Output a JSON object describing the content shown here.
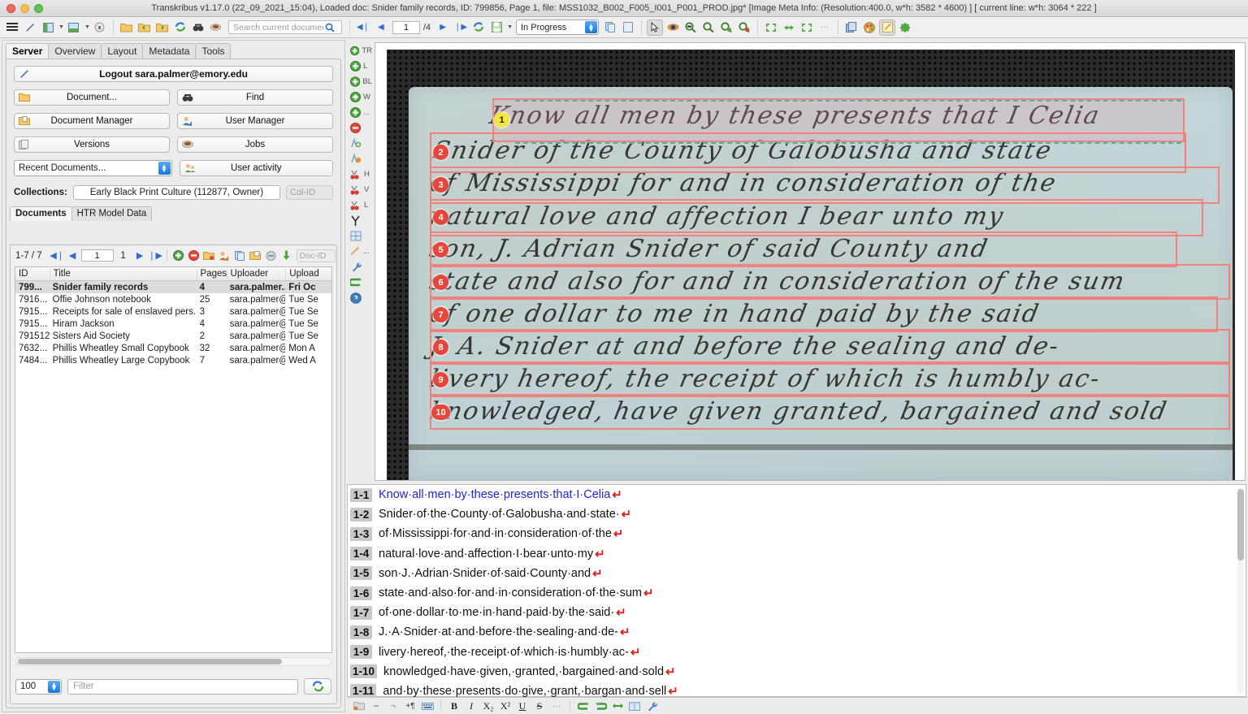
{
  "window": {
    "title": "Transkribus v1.17.0 (22_09_2021_15:04), Loaded doc: Snider family records, ID: 799856, Page 1, file: MSS1032_B002_F005_I001_P001_PROD.jpg* [Image Meta Info: (Resolution:400.0, w*h: 3582 * 4600) ] [ current line: w*h: 3064 * 222 ]"
  },
  "toolbar": {
    "search_placeholder": "Search current document...",
    "page_value": "1",
    "page_total": "/4",
    "status_value": "In Progress",
    "icons": [
      "hamburger-menu-icon",
      "pen-icon",
      "split-horizontal-icon",
      "split-vertical-icon",
      "lock-icon",
      "open-folder-icon",
      "import-document-icon",
      "export-document-icon",
      "reload-icon",
      "find-icon",
      "jobs-icon"
    ],
    "nav_icons": [
      "first-page-icon",
      "prev-page-icon",
      "next-page-icon",
      "last-page-icon",
      "reload-page-icon",
      "save-icon"
    ],
    "right_icons": [
      "copy-icon",
      "paste-icon",
      "pointer-icon",
      "eye-icon",
      "zoom-fit-width-icon",
      "zoom-icon",
      "zoom-in-icon",
      "zoom-out-icon",
      "fit-page-icon",
      "fit-width-icon",
      "fit-selection-icon",
      "more-icon",
      "layers-icon",
      "palette-icon",
      "edit-icon",
      "plugin-icon"
    ]
  },
  "sidebar": {
    "tabs": [
      {
        "label": "Server",
        "active": true
      },
      {
        "label": "Overview",
        "active": false
      },
      {
        "label": "Layout",
        "active": false
      },
      {
        "label": "Metadata",
        "active": false
      },
      {
        "label": "Tools",
        "active": false
      }
    ],
    "logout_label": "Logout sara.palmer@emory.edu",
    "buttons": [
      {
        "label": "Document...",
        "icon": "folder-icon"
      },
      {
        "label": "Find",
        "icon": "binoculars-icon"
      },
      {
        "label": "Document Manager",
        "icon": "document-manager-icon"
      },
      {
        "label": "User Manager",
        "icon": "user-manager-icon"
      },
      {
        "label": "Versions",
        "icon": "versions-icon"
      },
      {
        "label": "Jobs",
        "icon": "coffee-icon"
      }
    ],
    "recent_documents_label": "Recent Documents...",
    "user_activity_label": "User activity",
    "user_activity_icon": "user-activity-icon",
    "collections_label": "Collections:",
    "collection_value": "Early Black Print Culture (112877, Owner)",
    "colid_placeholder": "Col-ID",
    "sub_tabs": [
      {
        "label": "Documents",
        "active": true
      },
      {
        "label": "HTR Model Data",
        "active": false
      }
    ]
  },
  "docs": {
    "pager": {
      "range_label": "1-7 / 7",
      "page_value": "1",
      "page_total": "1",
      "docid_placeholder": "Doc-ID",
      "icons": [
        "first-page-icon",
        "prev-page-icon",
        "next-page-icon",
        "last-page-icon",
        "add-document-icon",
        "delete-document-icon",
        "duplicate-document-icon",
        "edit-metadata-icon",
        "copy-icon",
        "export-icon",
        "print-icon",
        "download-icon"
      ]
    },
    "columns": [
      "ID",
      "Title",
      "Pages",
      "Uploader",
      "Upload"
    ],
    "rows": [
      {
        "id": "799...",
        "title": "Snider family records",
        "pages": "4",
        "uploader": "sara.palmer...",
        "upload": "Fri Oc",
        "selected": true
      },
      {
        "id": "7916...",
        "title": "Offie Johnson notebook",
        "pages": "25",
        "uploader": "sara.palmer@...",
        "upload": "Tue Se",
        "selected": false
      },
      {
        "id": "7915...",
        "title": "Receipts for sale of enslaved pers...",
        "pages": "3",
        "uploader": "sara.palmer@...",
        "upload": "Tue Se",
        "selected": false
      },
      {
        "id": "7915...",
        "title": "Hiram Jackson",
        "pages": "4",
        "uploader": "sara.palmer@...",
        "upload": "Tue Se",
        "selected": false
      },
      {
        "id": "791512",
        "title": "Sisters Aid Society",
        "pages": "2",
        "uploader": "sara.palmer@...",
        "upload": "Tue Se",
        "selected": false
      },
      {
        "id": "7632...",
        "title": "Phillis Wheatley Small Copybook",
        "pages": "32",
        "uploader": "sara.palmer@...",
        "upload": "Mon A",
        "selected": false
      },
      {
        "id": "7484...",
        "title": "Phillis Wheatley Large Copybook",
        "pages": "7",
        "uploader": "sara.palmer@...",
        "upload": "Wed A",
        "selected": false
      }
    ],
    "count_value": "100",
    "filter_placeholder": "Filter",
    "refresh_icon": "refresh-icon"
  },
  "vtools": [
    {
      "icon": "add-icon",
      "label": "TR"
    },
    {
      "icon": "add-icon",
      "label": "L"
    },
    {
      "icon": "add-icon",
      "label": "BL"
    },
    {
      "icon": "add-icon",
      "label": "W"
    },
    {
      "icon": "add-icon",
      "label": "..."
    },
    {
      "icon": "remove-icon",
      "label": ""
    },
    {
      "icon": "add-baseline-icon",
      "label": ""
    },
    {
      "icon": "edit-baseline-icon",
      "label": ""
    },
    {
      "icon": "split-icon",
      "label": "H"
    },
    {
      "icon": "split-icon",
      "label": "V"
    },
    {
      "icon": "split-icon",
      "label": "L"
    },
    {
      "icon": "merge-icon",
      "label": ""
    },
    {
      "icon": "table-icon",
      "label": ""
    },
    {
      "icon": "pencil-icon",
      "label": "..."
    },
    {
      "icon": "wrench-icon",
      "label": ""
    },
    {
      "icon": "undo-icon",
      "label": ""
    },
    {
      "icon": "help-icon",
      "label": ""
    }
  ],
  "image": {
    "lines": [
      {
        "num": "1",
        "text": "Know all men by these presents that I Celia",
        "current": true
      },
      {
        "num": "2",
        "text": "Snider of the County of Galobusha and state",
        "current": false
      },
      {
        "num": "3",
        "text": "of Mississippi for and in consideration of the",
        "current": false
      },
      {
        "num": "4",
        "text": "natural love and affection I bear unto my",
        "current": false
      },
      {
        "num": "5",
        "text": "son, J. Adrian Snider of said County and",
        "current": false
      },
      {
        "num": "6",
        "text": "state and also for and in consideration of the sum",
        "current": false
      },
      {
        "num": "7",
        "text": "of one dollar to me in hand paid by the said",
        "current": false
      },
      {
        "num": "8",
        "text": "J. A. Snider at and before the sealing and de-",
        "current": false
      },
      {
        "num": "9",
        "text": "livery hereof, the receipt of which is humbly ac-",
        "current": false
      },
      {
        "num": "10",
        "text": "knowledged, have given granted, bargained and sold",
        "current": false
      }
    ]
  },
  "transcript": {
    "lines": [
      {
        "num": "1-1",
        "text": "Know·all·men·by·these·presents·that·I·Celia",
        "current": true
      },
      {
        "num": "1-2",
        "text": "Snider·of·the·County·of·Galobusha·and·state·",
        "current": false
      },
      {
        "num": "1-3",
        "text": "of·Mississippi·for·and·in·consideration·of·the",
        "current": false
      },
      {
        "num": "1-4",
        "text": "natural·love·and·affection·I·bear·unto·my",
        "current": false
      },
      {
        "num": "1-5",
        "text": "son·J.·Adrian·Snider·of·said·County·and",
        "current": false
      },
      {
        "num": "1-6",
        "text": "state·and·also·for·and·in·consideration·of·the·sum",
        "current": false
      },
      {
        "num": "1-7",
        "text": "of·one·dollar·to·me·in·hand·paid·by·the·said·",
        "current": false
      },
      {
        "num": "1-8",
        "text": "J.·A·Snider·at·and·before·the·sealing·and·de-",
        "current": false
      },
      {
        "num": "1-9",
        "text": "livery·hereof,·the·receipt·of·which·is·humbly·ac-",
        "current": false
      },
      {
        "num": "1-10",
        "text": "knowledged·have·given,·granted,·bargained·and·sold",
        "current": false
      },
      {
        "num": "1-11",
        "text": "and·by·these·presents·do·give,·grant,·bargan·and·sell",
        "current": false
      }
    ],
    "pilcrow": "↵"
  },
  "formatbar": {
    "icons": [
      "tag-icon",
      "dash-icon",
      "small-caps-icon",
      "paragraph-icon",
      "keyboard-icon",
      "bold-icon",
      "italic-icon",
      "subscript-icon",
      "superscript-icon",
      "underline-icon",
      "strikethrough-icon",
      "more-icon",
      "undo-icon",
      "redo-icon",
      "reading-order-icon",
      "columns-icon",
      "tools-icon"
    ],
    "labels": [
      "B",
      "I",
      "X₂",
      "X²",
      "U",
      "S",
      "..."
    ]
  },
  "colors": {
    "accent_blue": "#1477e0",
    "line_box_red": "#f2837c",
    "line_num_red": "#e8453c",
    "current_line_yellow": "#f5e63d",
    "transcript_current_blue": "#2222dd",
    "pilcrow_red": "#e02020",
    "baseline_teal": "#46b3a8",
    "paper_blue": "#c4d5d8"
  }
}
